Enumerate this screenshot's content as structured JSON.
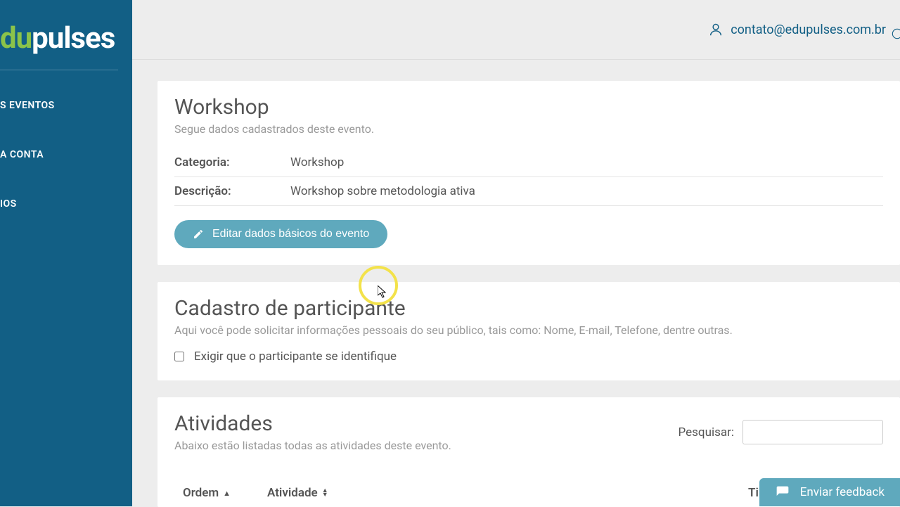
{
  "brand": {
    "part1": "du",
    "part2": "pulses"
  },
  "sidebar": {
    "items": [
      {
        "label": "S EVENTOS"
      },
      {
        "label": "A CONTA"
      },
      {
        "label": "IOS"
      }
    ]
  },
  "header": {
    "email": "contato@edupulses.com.br"
  },
  "event": {
    "title": "Workshop",
    "subtitle": "Segue dados cadastrados deste evento.",
    "category_label": "Categoria:",
    "category_value": "Workshop",
    "description_label": "Descrição:",
    "description_value": "Workshop sobre metodologia ativa",
    "edit_button": "Editar dados básicos do evento"
  },
  "participant": {
    "title": "Cadastro de participante",
    "subtitle": "Aqui você pode solicitar informações pessoais do seu público, tais como: Nome, E-mail, Telefone, dentre outras.",
    "require_label": "Exigir que o participante se identifique",
    "require_checked": false
  },
  "activities": {
    "title": "Atividades",
    "subtitle": "Abaixo estão listadas todas as atividades deste evento.",
    "search_label": "Pesquisar:",
    "columns": {
      "ordem": "Ordem",
      "atividade": "Atividade",
      "tipo": "Tipo"
    }
  },
  "feedback": {
    "label": "Enviar feedback"
  }
}
